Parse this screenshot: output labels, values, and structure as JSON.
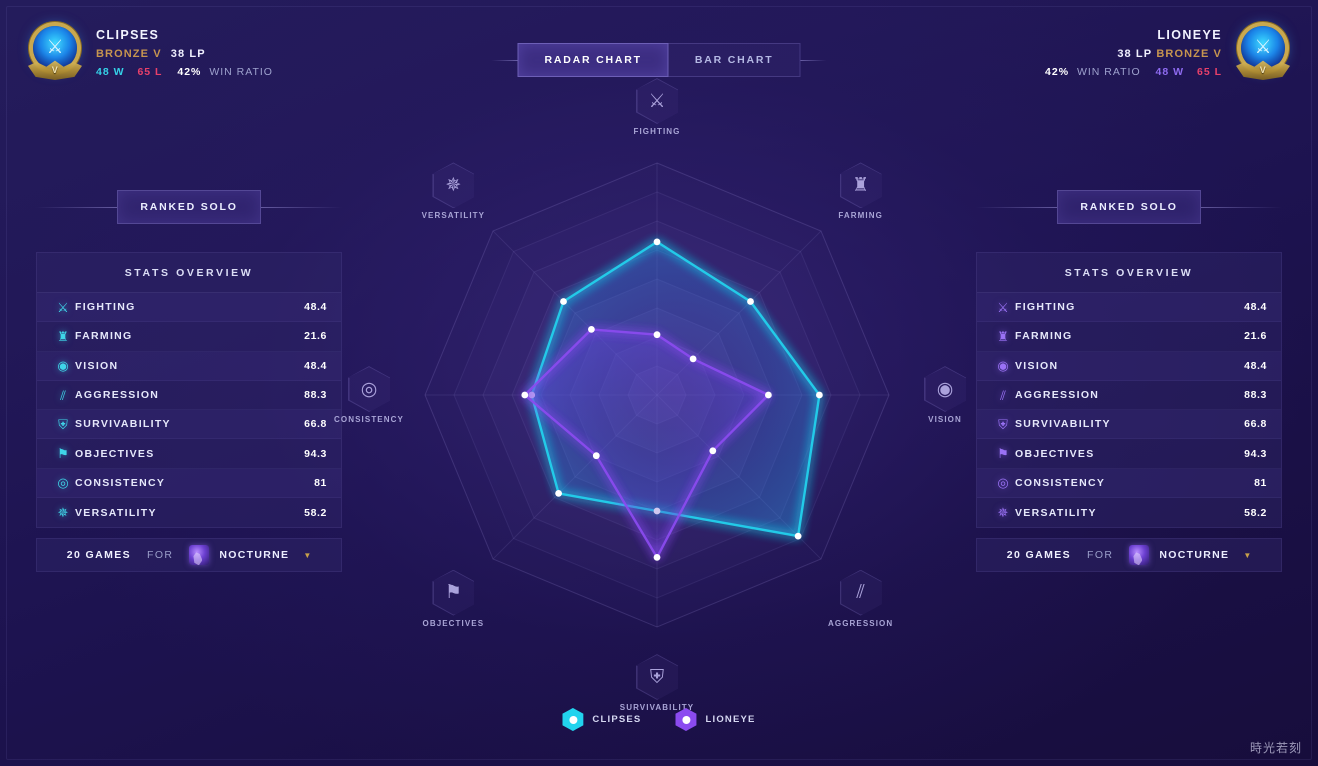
{
  "header": {
    "left_player": {
      "name": "CLIPSES",
      "tier": "BRONZE V",
      "lp": "38 LP",
      "wins": "48 W",
      "losses": "65 L",
      "win_ratio": "42%",
      "win_ratio_label": "WIN RATIO",
      "emblem_icon": "crossed-swords-icon",
      "division_letter": "V"
    },
    "right_player": {
      "name": "LIONEYE",
      "tier": "BRONZE V",
      "lp": "38 LP",
      "wins": "48 W",
      "losses": "65 L",
      "win_ratio": "42%",
      "win_ratio_label": "WIN RATIO",
      "emblem_icon": "crossed-swords-icon",
      "division_letter": "V"
    },
    "tabs": [
      {
        "label": "RADAR CHART",
        "active": true
      },
      {
        "label": "BAR CHART",
        "active": false
      }
    ]
  },
  "left_panel": {
    "queue_badge": "RANKED SOLO",
    "card_title": "STATS OVERVIEW",
    "rows": [
      {
        "icon": "sword-icon",
        "glyph": "⚔",
        "label": "FIGHTING",
        "value": "48.4"
      },
      {
        "icon": "minion-icon",
        "glyph": "♜",
        "label": "FARMING",
        "value": "21.6"
      },
      {
        "icon": "eye-icon",
        "glyph": "◉",
        "label": "VISION",
        "value": "48.4"
      },
      {
        "icon": "slashes-icon",
        "glyph": "⫽",
        "label": "AGGRESSION",
        "value": "88.3"
      },
      {
        "icon": "shield-icon",
        "glyph": "⛨",
        "label": "SURVIVABILITY",
        "value": "66.8"
      },
      {
        "icon": "flag-icon",
        "glyph": "⚑",
        "label": "OBJECTIVES",
        "value": "94.3"
      },
      {
        "icon": "target-icon",
        "glyph": "◎",
        "label": "CONSISTENCY",
        "value": "81"
      },
      {
        "icon": "atom-icon",
        "glyph": "✵",
        "label": "VERSATILITY",
        "value": "58.2"
      }
    ],
    "games_count": "20 GAMES",
    "games_for": "FOR",
    "champion": "NOCTURNE",
    "dropdown_icon": "caret-down-icon"
  },
  "right_panel": {
    "queue_badge": "RANKED SOLO",
    "card_title": "STATS OVERVIEW",
    "rows": [
      {
        "icon": "sword-icon",
        "glyph": "⚔",
        "label": "FIGHTING",
        "value": "48.4"
      },
      {
        "icon": "minion-icon",
        "glyph": "♜",
        "label": "FARMING",
        "value": "21.6"
      },
      {
        "icon": "eye-icon",
        "glyph": "◉",
        "label": "VISION",
        "value": "48.4"
      },
      {
        "icon": "slashes-icon",
        "glyph": "⫽",
        "label": "AGGRESSION",
        "value": "88.3"
      },
      {
        "icon": "shield-icon",
        "glyph": "⛨",
        "label": "SURVIVABILITY",
        "value": "66.8"
      },
      {
        "icon": "flag-icon",
        "glyph": "⚑",
        "label": "OBJECTIVES",
        "value": "94.3"
      },
      {
        "icon": "target-icon",
        "glyph": "◎",
        "label": "CONSISTENCY",
        "value": "81"
      },
      {
        "icon": "atom-icon",
        "glyph": "✵",
        "label": "VERSATILITY",
        "value": "58.2"
      }
    ],
    "games_count": "20 GAMES",
    "games_for": "FOR",
    "champion": "NOCTURNE",
    "dropdown_icon": "caret-down-icon"
  },
  "legend": [
    {
      "label": "CLIPSES",
      "color": "#22d3ee"
    },
    {
      "label": "LIONEYE",
      "color": "#8b4bf0"
    }
  ],
  "watermark": "時光若刻",
  "chart_data": {
    "type": "radar",
    "title": "RADAR CHART",
    "axes": [
      {
        "label": "FIGHTING",
        "icon": "sword-icon",
        "glyph": "⚔",
        "angle": -90
      },
      {
        "label": "FARMING",
        "icon": "minion-icon",
        "glyph": "♜",
        "angle": -45
      },
      {
        "label": "VISION",
        "icon": "eye-icon",
        "glyph": "◉",
        "angle": 0
      },
      {
        "label": "AGGRESSION",
        "icon": "slashes-icon",
        "glyph": "⫽",
        "angle": 45
      },
      {
        "label": "SURVIVABILITY",
        "icon": "shield-icon",
        "glyph": "⛨",
        "angle": 90
      },
      {
        "label": "OBJECTIVES",
        "icon": "flag-icon",
        "glyph": "⚑",
        "angle": 135
      },
      {
        "label": "CONSISTENCY",
        "icon": "target-icon",
        "glyph": "◎",
        "angle": 180
      },
      {
        "label": "VERSATILITY",
        "icon": "atom-icon",
        "glyph": "✵",
        "angle": -135
      }
    ],
    "rings": 8,
    "rmax": 100,
    "grid": true,
    "legend_position": "bottom",
    "series": [
      {
        "name": "CLIPSES",
        "color": "#22d3ee",
        "fill": "rgba(46,150,232,0.30)",
        "values": [
          66,
          57,
          70,
          86,
          50,
          60,
          54,
          57
        ]
      },
      {
        "name": "LIONEYE",
        "color": "#8b4bf0",
        "fill": "rgba(108,70,225,0.34)",
        "values": [
          26,
          22,
          48,
          34,
          70,
          37,
          57,
          40
        ]
      }
    ]
  }
}
